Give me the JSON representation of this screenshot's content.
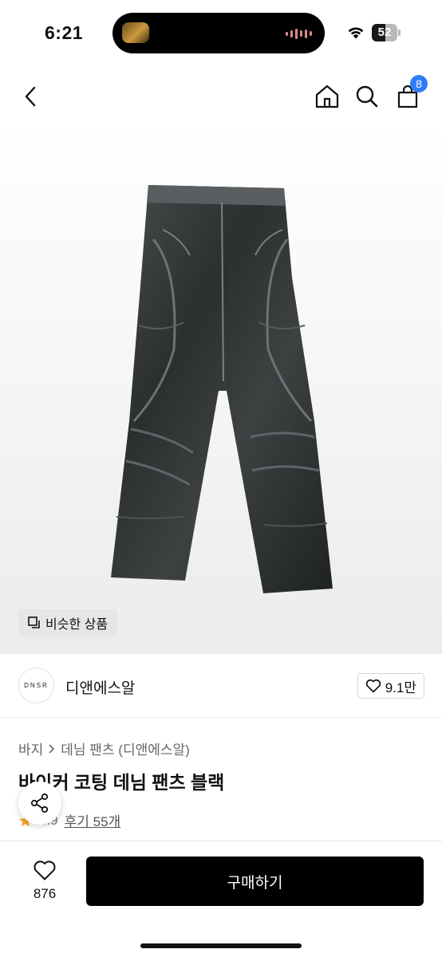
{
  "status": {
    "time": "6:21",
    "battery": "52",
    "battery_level": 0.52
  },
  "nav": {
    "cart_count": "8"
  },
  "hero": {
    "similar_label": "비슷한 상품"
  },
  "brand": {
    "logo_text": "DNSR",
    "name": "디앤에스알",
    "likes": "9.1만"
  },
  "product": {
    "breadcrumb_category": "바지",
    "breadcrumb_sub": "데님 팬츠 (디앤에스알)",
    "title": "바이커 코팅 데님 팬츠 블랙",
    "rating": "4.9",
    "reviews": "후기 55개"
  },
  "bottom": {
    "like_count": "876",
    "buy_label": "구매하기"
  },
  "colors": {
    "accent": "#2f7df6",
    "star": "#f5a623",
    "buy_button": "#000000"
  },
  "icons": [
    "back-icon",
    "home-icon",
    "search-icon",
    "bag-icon",
    "copy-icon",
    "heart-icon",
    "share-icon",
    "star-icon",
    "wifi-icon"
  ]
}
